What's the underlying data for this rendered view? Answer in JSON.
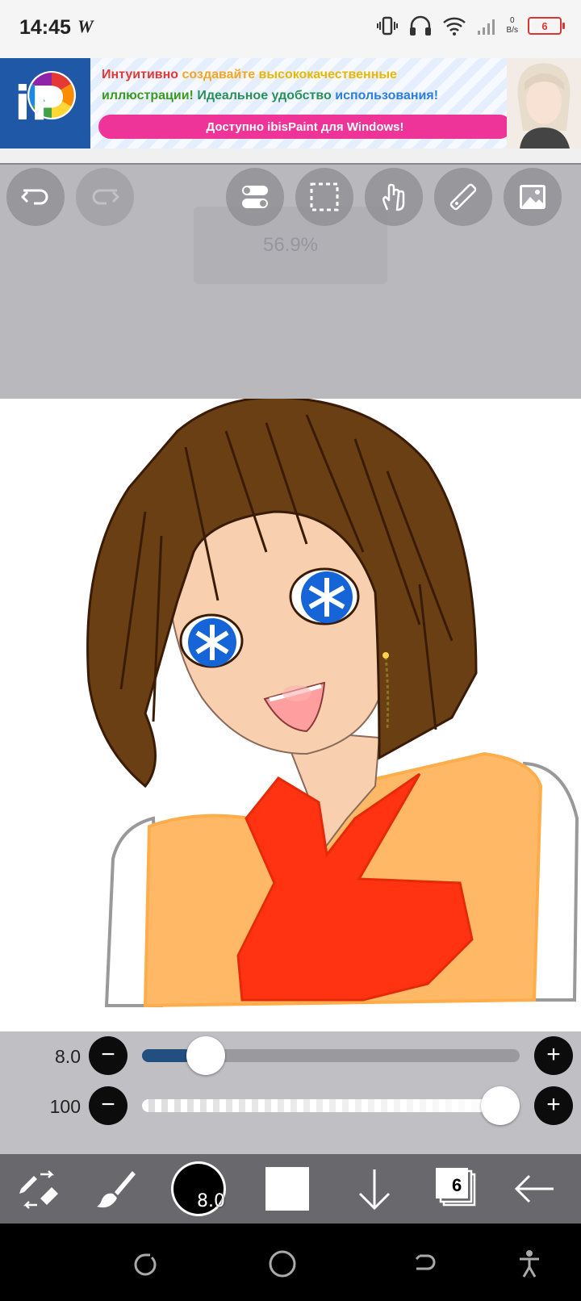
{
  "status_bar": {
    "time": "14:45",
    "app_glyph": "W",
    "net_speed_value": "0",
    "net_speed_unit": "B/s",
    "battery": "6",
    "icons": [
      "vibrate-icon",
      "headphones-icon",
      "wifi-icon",
      "signal-icon",
      "battery-icon"
    ]
  },
  "ad": {
    "line1_part1": "Интуитивно",
    "line1_part2": "создавайте",
    "line1_part3": "высококачественные",
    "line2_part1": "иллюстрации!",
    "line2_part2": "Идеальное удобство",
    "line2_part3": "использования!",
    "cta": "Доступно ibisPaint для Windows!",
    "logo_text": "iP",
    "colors": {
      "red": "#ee4422",
      "orange": "#f5a623",
      "green": "#44aa22",
      "blue": "#2b7de0",
      "cta": "#ee3399"
    }
  },
  "canvas_toolbar": {
    "zoom": "56.9%",
    "buttons": [
      "undo-icon",
      "redo-icon",
      "toggle-icon",
      "selection-icon",
      "hand-icon",
      "ruler-icon",
      "image-icon"
    ]
  },
  "brush": {
    "size_label": "8.0",
    "opacity_label": "100",
    "size_fraction": 0.13,
    "opacity_fraction": 1.0,
    "minus": "−",
    "plus": "+"
  },
  "bottom_toolbar": {
    "brush_size": "8.0",
    "layers_count": "6",
    "items": [
      "tool-switch-icon",
      "brush-icon",
      "brush-size-icon",
      "color-icon",
      "download-icon",
      "layers-icon",
      "back-arrow-icon"
    ]
  },
  "nav_bar": {
    "items": [
      "rotate-icon",
      "home-icon",
      "back-icon",
      "accessibility-icon"
    ]
  }
}
